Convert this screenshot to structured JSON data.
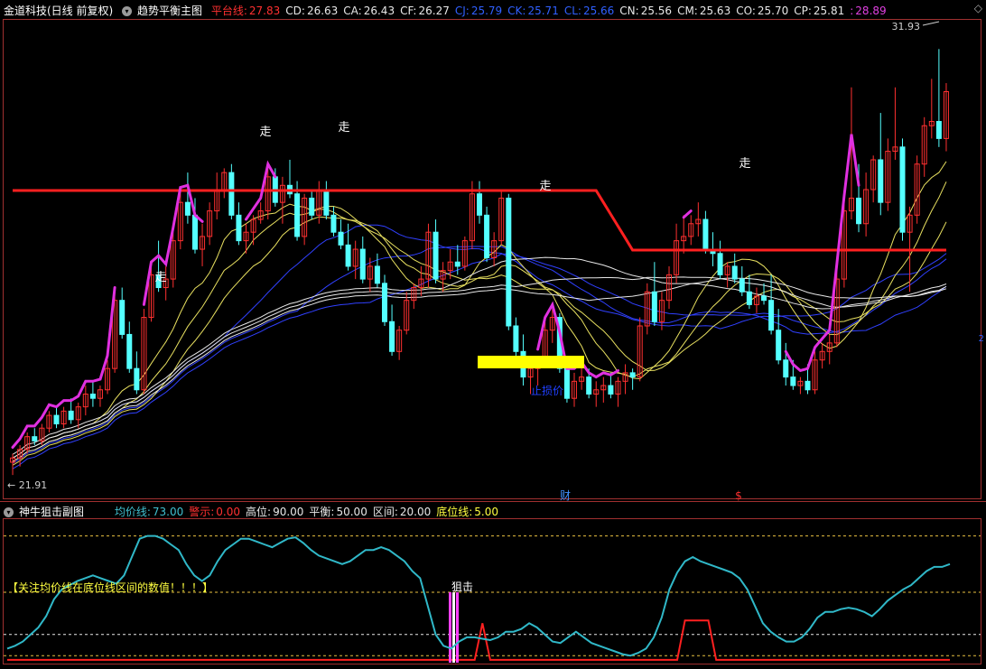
{
  "main_header": {
    "stock_title": "金道科技(日线 前复权)",
    "indicator_name": "趋势平衡主图",
    "items": [
      {
        "label": "平台线:",
        "value": "27.83",
        "color": "#ff3030"
      },
      {
        "label": "CD:",
        "value": "26.63",
        "color": "#e8e8e8"
      },
      {
        "label": "CA:",
        "value": "26.43",
        "color": "#e8e8e8"
      },
      {
        "label": "CF:",
        "value": "26.27",
        "color": "#e8e8e8"
      },
      {
        "label": "CJ:",
        "value": "25.79",
        "color": "#3060ff"
      },
      {
        "label": "CK:",
        "value": "25.71",
        "color": "#3060ff"
      },
      {
        "label": "CL:",
        "value": "25.66",
        "color": "#3060ff"
      },
      {
        "label": "CN:",
        "value": "25.56",
        "color": "#e8e8e8"
      },
      {
        "label": "CM:",
        "value": "25.63",
        "color": "#e8e8e8"
      },
      {
        "label": "CO:",
        "value": "25.70",
        "color": "#e8e8e8"
      },
      {
        "label": "CP:",
        "value": "25.81",
        "color": "#e8e8e8"
      },
      {
        "label": ":",
        "value": "28.89",
        "color": "#e040e0"
      }
    ]
  },
  "sub_header": {
    "indicator_name": "神牛狙击副图",
    "items": [
      {
        "label": "均价线:",
        "value": "73.00",
        "color": "#40c0d0"
      },
      {
        "label": "警示:",
        "value": "0.00",
        "color": "#ff3030"
      },
      {
        "label": "高位:",
        "value": "90.00",
        "color": "#e8e8e8"
      },
      {
        "label": "平衡:",
        "value": "50.00",
        "color": "#e8e8e8"
      },
      {
        "label": "区间:",
        "value": "20.00",
        "color": "#e8e8e8"
      },
      {
        "label": "底位线:",
        "value": "5.00",
        "color": "#ffff40"
      }
    ]
  },
  "annotations": {
    "high_label": "31.93",
    "low_label": "← 21.91",
    "walk_label": "走",
    "stop_loss_label": "止损价",
    "finance_marker": "财",
    "dollar_marker": "$",
    "snipe_label": "狙击",
    "notice_text": "【关注均价线在底位线区间的数值！！！】",
    "diamond": "◇"
  },
  "colors": {
    "up_candle": "#ff3030",
    "down_candle": "#54ffff",
    "platform_line": "#ff2020",
    "trend_line": "#e030e0",
    "ma_white": "#e8e8e8",
    "ma_yellow": "#e8e060",
    "ma_blue": "#3040ff",
    "avg_line": "#30b8c8",
    "stoploss_bar": "#ffff00"
  },
  "chart_data": [
    {
      "type": "candlestick",
      "ylim": [
        21.5,
        32.5
      ],
      "candles": [
        [
          22.2,
          22.4,
          21.9,
          22.3
        ],
        [
          22.3,
          22.6,
          22.1,
          22.5
        ],
        [
          22.5,
          22.9,
          22.4,
          22.8
        ],
        [
          22.8,
          23.0,
          22.6,
          22.7
        ],
        [
          22.7,
          23.1,
          22.6,
          23.0
        ],
        [
          23.0,
          23.4,
          22.9,
          23.3
        ],
        [
          23.3,
          23.5,
          23.0,
          23.1
        ],
        [
          23.1,
          23.5,
          23.0,
          23.4
        ],
        [
          23.4,
          23.7,
          23.1,
          23.2
        ],
        [
          23.2,
          23.6,
          23.0,
          23.5
        ],
        [
          23.5,
          24.0,
          23.3,
          23.8
        ],
        [
          23.8,
          24.1,
          23.5,
          23.7
        ],
        [
          23.7,
          24.0,
          23.5,
          23.9
        ],
        [
          23.9,
          24.6,
          23.8,
          24.4
        ],
        [
          24.4,
          26.2,
          24.3,
          26.0
        ],
        [
          26.0,
          26.3,
          25.1,
          25.2
        ],
        [
          25.2,
          25.5,
          24.3,
          24.4
        ],
        [
          24.4,
          24.8,
          23.8,
          23.9
        ],
        [
          23.9,
          25.8,
          23.8,
          25.6
        ],
        [
          25.6,
          26.8,
          25.5,
          26.6
        ],
        [
          26.6,
          27.4,
          26.2,
          26.3
        ],
        [
          26.3,
          26.8,
          26.0,
          26.5
        ],
        [
          26.5,
          27.6,
          26.3,
          27.4
        ],
        [
          27.4,
          28.6,
          27.2,
          28.3
        ],
        [
          28.3,
          29.0,
          27.8,
          28.0
        ],
        [
          28.0,
          28.4,
          27.1,
          27.2
        ],
        [
          27.2,
          27.8,
          26.8,
          27.5
        ],
        [
          27.5,
          28.3,
          27.3,
          28.1
        ],
        [
          28.1,
          29.0,
          27.9,
          28.6
        ],
        [
          28.6,
          29.1,
          28.4,
          29.0
        ],
        [
          29.0,
          29.2,
          27.9,
          28.0
        ],
        [
          28.0,
          28.3,
          27.3,
          27.4
        ],
        [
          27.4,
          27.8,
          27.1,
          27.6
        ],
        [
          27.6,
          28.0,
          27.3,
          27.9
        ],
        [
          27.9,
          28.3,
          27.8,
          28.1
        ],
        [
          28.1,
          29.1,
          27.9,
          28.9
        ],
        [
          28.9,
          29.1,
          28.2,
          28.3
        ],
        [
          28.3,
          28.9,
          27.8,
          28.7
        ],
        [
          28.7,
          29.3,
          28.4,
          28.5
        ],
        [
          28.5,
          28.8,
          27.4,
          27.5
        ],
        [
          27.5,
          28.5,
          27.3,
          28.4
        ],
        [
          28.4,
          28.6,
          27.9,
          28.0
        ],
        [
          28.0,
          28.8,
          27.8,
          28.6
        ],
        [
          28.6,
          28.8,
          27.9,
          28.0
        ],
        [
          28.0,
          28.2,
          27.5,
          27.6
        ],
        [
          27.6,
          27.9,
          27.2,
          27.3
        ],
        [
          27.3,
          27.8,
          26.7,
          26.8
        ],
        [
          26.8,
          27.4,
          26.5,
          27.2
        ],
        [
          27.2,
          27.5,
          26.4,
          26.5
        ],
        [
          26.5,
          27.0,
          26.2,
          26.8
        ],
        [
          26.8,
          27.1,
          26.3,
          26.4
        ],
        [
          26.4,
          26.6,
          25.4,
          25.5
        ],
        [
          25.5,
          25.9,
          24.7,
          24.8
        ],
        [
          24.8,
          25.4,
          24.6,
          25.3
        ],
        [
          25.3,
          26.2,
          25.2,
          26.0
        ],
        [
          26.0,
          26.4,
          25.8,
          26.3
        ],
        [
          26.3,
          26.8,
          26.1,
          26.5
        ],
        [
          26.5,
          27.8,
          26.3,
          27.6
        ],
        [
          27.6,
          27.9,
          26.4,
          26.5
        ],
        [
          26.5,
          26.9,
          26.2,
          26.7
        ],
        [
          26.7,
          27.2,
          26.5,
          26.9
        ],
        [
          26.9,
          27.3,
          26.6,
          26.8
        ],
        [
          26.8,
          27.5,
          26.7,
          27.4
        ],
        [
          27.4,
          28.8,
          27.2,
          28.5
        ],
        [
          28.5,
          28.8,
          27.8,
          28.0
        ],
        [
          28.0,
          28.2,
          26.9,
          27.0
        ],
        [
          27.0,
          27.6,
          26.8,
          27.4
        ],
        [
          27.4,
          28.6,
          27.3,
          28.4
        ],
        [
          28.4,
          28.5,
          25.3,
          25.4
        ],
        [
          25.4,
          25.6,
          24.6,
          24.8
        ],
        [
          24.8,
          25.2,
          24.0,
          24.2
        ],
        [
          24.2,
          24.5,
          23.8,
          24.4
        ],
        [
          24.4,
          24.7,
          24.0,
          24.6
        ],
        [
          24.6,
          25.5,
          24.5,
          25.3
        ],
        [
          25.3,
          25.8,
          25.0,
          25.6
        ],
        [
          25.6,
          25.7,
          24.3,
          24.4
        ],
        [
          24.4,
          24.7,
          23.6,
          23.7
        ],
        [
          23.7,
          24.3,
          23.5,
          24.1
        ],
        [
          24.1,
          24.5,
          23.9,
          24.2
        ],
        [
          24.2,
          24.4,
          23.7,
          23.8
        ],
        [
          23.8,
          24.1,
          23.5,
          23.9
        ],
        [
          23.9,
          24.2,
          23.6,
          24.0
        ],
        [
          24.0,
          24.3,
          23.7,
          23.8
        ],
        [
          23.8,
          24.2,
          23.5,
          24.1
        ],
        [
          24.1,
          24.5,
          23.8,
          24.3
        ],
        [
          24.3,
          24.4,
          23.9,
          24.2
        ],
        [
          24.2,
          25.6,
          24.1,
          25.4
        ],
        [
          25.4,
          26.4,
          25.2,
          26.2
        ],
        [
          26.2,
          26.9,
          25.4,
          25.5
        ],
        [
          25.5,
          26.2,
          25.3,
          26.0
        ],
        [
          26.0,
          26.8,
          25.8,
          26.6
        ],
        [
          26.6,
          27.8,
          26.4,
          27.4
        ],
        [
          27.4,
          28.0,
          27.1,
          27.5
        ],
        [
          27.5,
          28.0,
          27.3,
          27.8
        ],
        [
          27.8,
          28.3,
          27.5,
          27.9
        ],
        [
          27.9,
          28.1,
          27.1,
          27.2
        ],
        [
          27.2,
          27.6,
          26.8,
          27.1
        ],
        [
          27.1,
          27.4,
          26.5,
          26.6
        ],
        [
          26.6,
          26.9,
          26.3,
          26.8
        ],
        [
          26.8,
          27.1,
          26.4,
          26.5
        ],
        [
          26.5,
          26.8,
          26.1,
          26.2
        ],
        [
          26.2,
          26.6,
          25.8,
          25.9
        ],
        [
          25.9,
          26.3,
          25.7,
          26.1
        ],
        [
          26.1,
          26.4,
          25.9,
          26.0
        ],
        [
          26.0,
          26.6,
          25.2,
          25.3
        ],
        [
          25.3,
          25.8,
          24.5,
          24.6
        ],
        [
          24.6,
          25.0,
          24.0,
          24.2
        ],
        [
          24.2,
          24.6,
          23.9,
          24.0
        ],
        [
          24.0,
          24.2,
          23.8,
          24.1
        ],
        [
          24.1,
          24.5,
          23.8,
          23.9
        ],
        [
          23.9,
          24.8,
          23.8,
          24.6
        ],
        [
          24.6,
          25.0,
          24.4,
          24.8
        ],
        [
          24.8,
          25.2,
          24.5,
          25.0
        ],
        [
          25.0,
          26.8,
          24.9,
          26.5
        ],
        [
          26.5,
          28.4,
          26.3,
          28.1
        ],
        [
          28.1,
          31.0,
          27.9,
          28.4
        ],
        [
          28.4,
          29.2,
          27.6,
          27.8
        ],
        [
          27.8,
          29.0,
          27.5,
          28.6
        ],
        [
          28.6,
          29.4,
          28.3,
          29.3
        ],
        [
          29.3,
          30.4,
          28.0,
          28.3
        ],
        [
          28.3,
          29.8,
          28.1,
          29.5
        ],
        [
          29.5,
          31.0,
          29.3,
          29.6
        ],
        [
          29.6,
          29.8,
          27.4,
          27.6
        ],
        [
          27.6,
          28.2,
          26.2,
          28.0
        ],
        [
          28.0,
          29.4,
          27.8,
          29.2
        ],
        [
          29.2,
          30.3,
          28.9,
          30.1
        ],
        [
          30.1,
          31.2,
          29.8,
          30.2
        ],
        [
          30.2,
          31.9,
          29.6,
          29.8
        ],
        [
          29.8,
          31.1,
          29.5,
          30.9
        ]
      ]
    },
    {
      "type": "line",
      "ylim": [
        0,
        100
      ],
      "series": [
        {
          "values": [
            10,
            12,
            15,
            20,
            25,
            33,
            45,
            52,
            55,
            58,
            60,
            62,
            60,
            58,
            56,
            62,
            75,
            88,
            90,
            90,
            88,
            84,
            80,
            70,
            62,
            58,
            62,
            72,
            80,
            84,
            88,
            88,
            86,
            84,
            82,
            85,
            88,
            89,
            85,
            80,
            76,
            74,
            72,
            70,
            72,
            76,
            80,
            80,
            82,
            80,
            76,
            72,
            65,
            60,
            40,
            20,
            12,
            10,
            15,
            18,
            18,
            17,
            16,
            18,
            22,
            22,
            24,
            28,
            25,
            20,
            15,
            14,
            18,
            22,
            18,
            14,
            12,
            10,
            8,
            6,
            5,
            7,
            10,
            18,
            32,
            52,
            64,
            72,
            75,
            72,
            70,
            68,
            66,
            64,
            60,
            52,
            40,
            28,
            22,
            18,
            15,
            15,
            18,
            24,
            32,
            36,
            36,
            38,
            39,
            38,
            36,
            33,
            38,
            44,
            48,
            52,
            55,
            60,
            65,
            68,
            68,
            70
          ]
        }
      ]
    }
  ]
}
